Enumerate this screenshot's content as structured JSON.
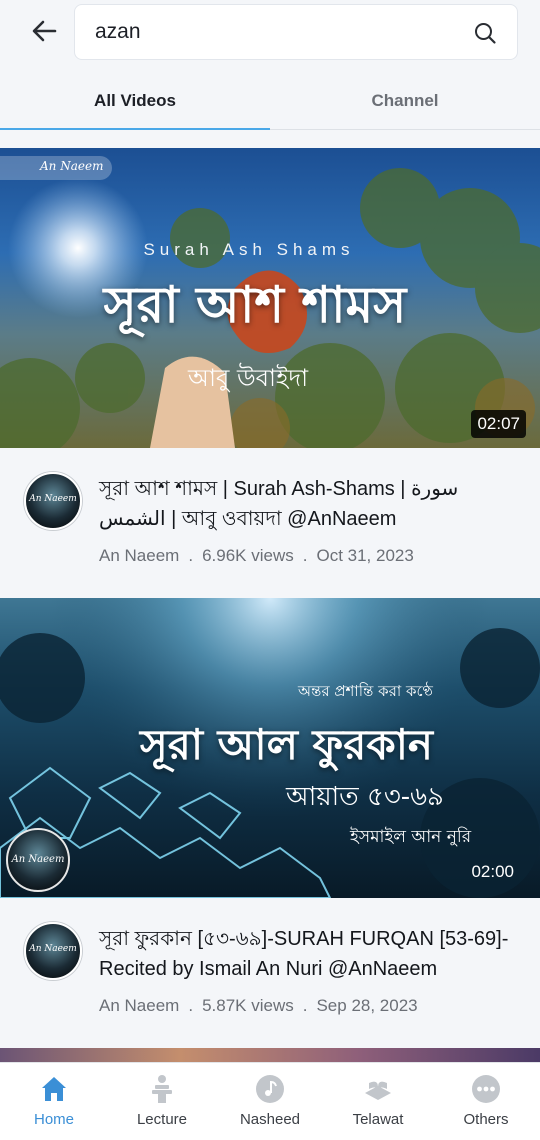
{
  "search": {
    "query": "azan",
    "back_icon": "arrow-left-icon",
    "icon": "search-icon"
  },
  "tabs": [
    {
      "label": "All Videos",
      "active": true
    },
    {
      "label": "Channel",
      "active": false
    }
  ],
  "videos": [
    {
      "thumbnail": {
        "brand": "An Naeem",
        "subtitle": "Surah Ash Shams",
        "title": "সূরা আশ শামস",
        "reciter": "আবু উবাইদা"
      },
      "duration": "02:07",
      "title": "সূরা আশ শামস | Surah Ash-Shams | سورة الشمس | আবু ওবায়দা @AnNaeem",
      "channel": "An Naeem",
      "views": "6.96K views",
      "date": "Oct 31, 2023"
    },
    {
      "thumbnail": {
        "tagline": "অন্তর প্রশান্তি করা কণ্ঠে",
        "title": "সূরা আল ফুরকান",
        "verses": "আয়াত ৫৩-৬৯",
        "reciter": "ইসমাইল আন নুরি",
        "brand": "An Naeem"
      },
      "duration": "02:00",
      "title": "সূরা ফুরকান [৫৩-৬৯]-SURAH FURQAN [53-69]-Recited by Ismail An Nuri @AnNaeem",
      "channel": "An Naeem",
      "views": "5.87K views",
      "date": "Sep 28, 2023"
    }
  ],
  "separator": ".",
  "bottom_nav": [
    {
      "label": "Home",
      "icon": "home-icon",
      "active": true
    },
    {
      "label": "Lecture",
      "icon": "lecture-icon",
      "active": false
    },
    {
      "label": "Nasheed",
      "icon": "nasheed-icon",
      "active": false
    },
    {
      "label": "Telawat",
      "icon": "quran-icon",
      "active": false
    },
    {
      "label": "Others",
      "icon": "more-icon",
      "active": false
    }
  ],
  "colors": {
    "accent": "#3b8fd6",
    "tab_indicator": "#4aa8e8",
    "text": "#14171c",
    "muted": "#6b6f76",
    "background": "#f4f6f9"
  }
}
